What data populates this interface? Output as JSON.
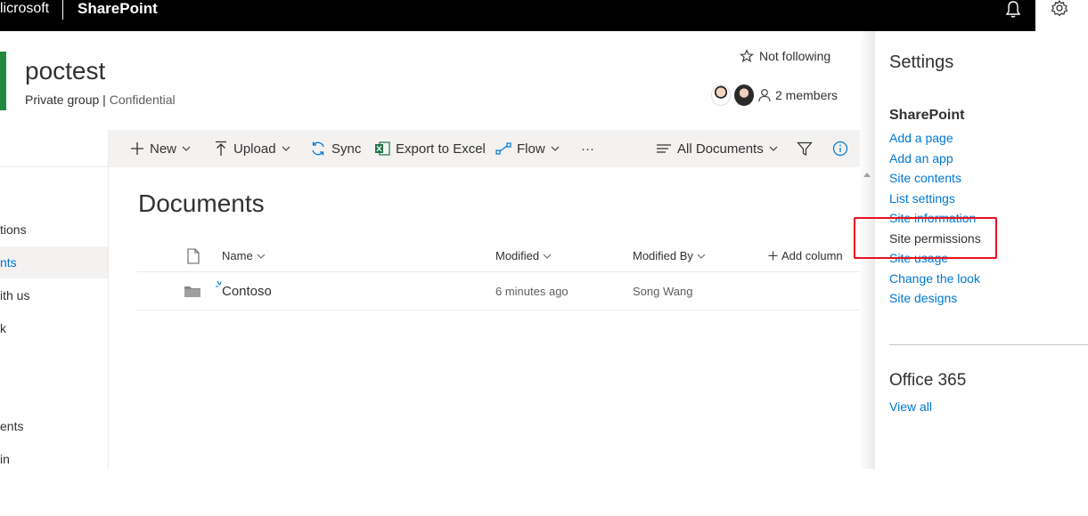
{
  "suitebar": {
    "brand": "Microsoft",
    "brand_visible": "licrosoft",
    "app_name": "SharePoint",
    "icons": [
      "bell-icon",
      "gear-icon"
    ]
  },
  "site": {
    "title": "poctest",
    "privacy": "Private group",
    "separator": "|",
    "classification": "Confidential",
    "follow_label": "Not following",
    "members_label": "2 members"
  },
  "leftnav": {
    "items": [
      {
        "label": "tions",
        "selected": false
      },
      {
        "label": "nts",
        "selected": true
      },
      {
        "label": "ith us",
        "selected": false
      },
      {
        "label": "k",
        "selected": false
      },
      {
        "label": "ents",
        "selected": false
      },
      {
        "label": "in",
        "selected": false
      }
    ]
  },
  "commandbar": {
    "new_label": "New",
    "upload_label": "Upload",
    "sync_label": "Sync",
    "export_label": "Export to Excel",
    "flow_label": "Flow",
    "more_label": "···",
    "view_label": "All Documents"
  },
  "library": {
    "title": "Documents",
    "columns": {
      "name": "Name",
      "modified": "Modified",
      "modified_by": "Modified By",
      "add_column": "Add column"
    },
    "rows": [
      {
        "name": "Contoso",
        "modified": "6 minutes ago",
        "modified_by": "Song Wang"
      }
    ]
  },
  "settings": {
    "title": "Settings",
    "section_sharepoint": "SharePoint",
    "links": [
      "Add a page",
      "Add an app",
      "Site contents",
      "List settings",
      "Site information",
      "Site permissions",
      "Site usage",
      "Change the look",
      "Site designs"
    ],
    "section_office": "Office 365",
    "view_all": "View all"
  },
  "colors": {
    "accent": "#0078d4",
    "site_bar": "#218a3e",
    "highlight": "#e81123",
    "excel_green": "#217346"
  }
}
